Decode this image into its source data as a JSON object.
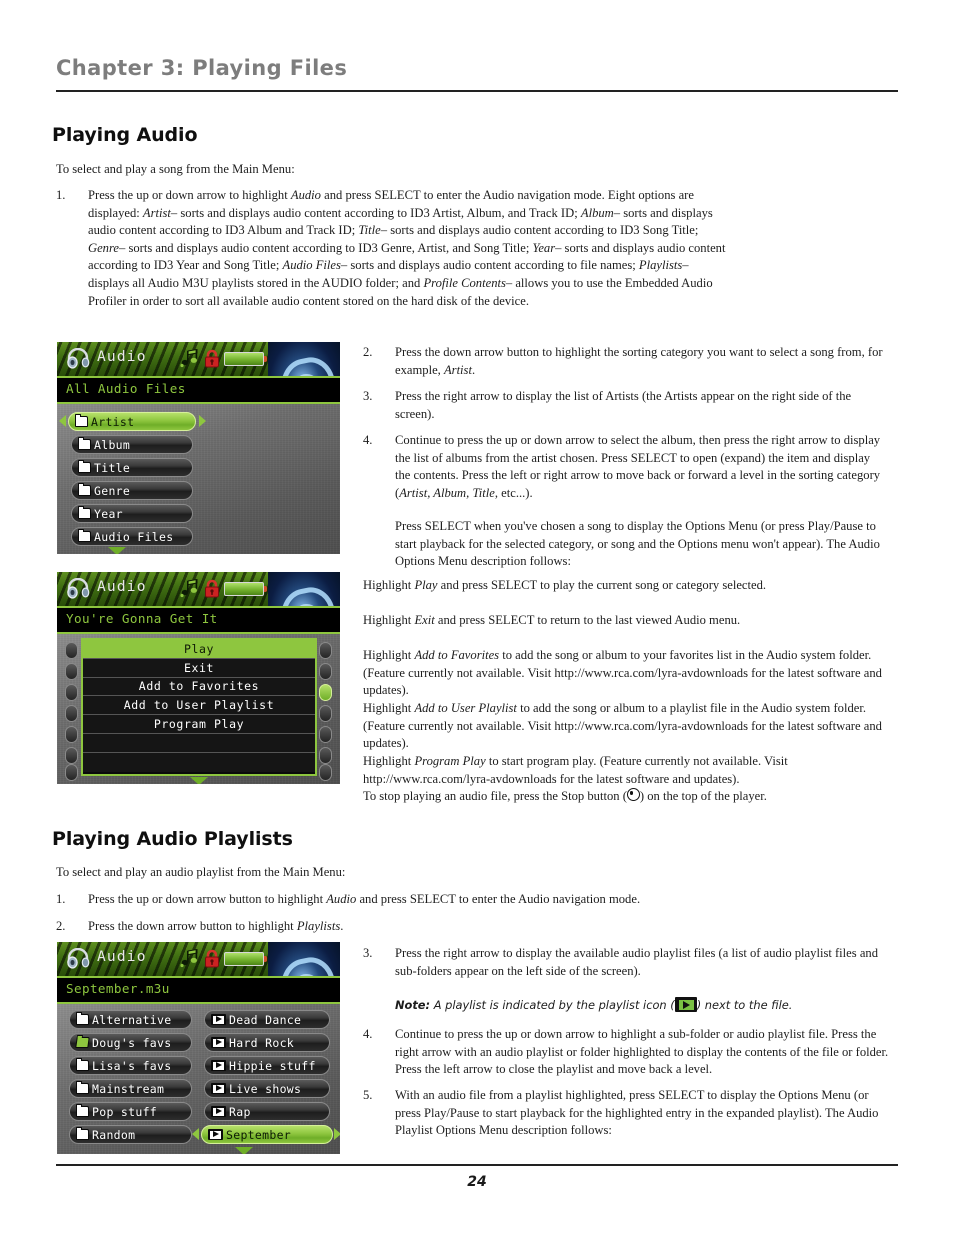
{
  "page": {
    "chapter_title": "Chapter 3: Playing Files",
    "page_number": "24"
  },
  "section_audio": {
    "heading": "Playing Audio",
    "intro": "To select and play a song from the Main Menu:",
    "step1_num": "1.",
    "step1_text": "Press the up or down arrow to highlight Audio and press SELECT to enter the Audio navigation mode. Eight options are displayed: Artist– sorts and displays audio content according to ID3 Artist, Album, and Track ID; Album– sorts and displays audio content according to ID3 Album and Track ID; Title– sorts and displays audio content according to ID3 Song Title; Genre– sorts and displays audio content according to ID3 Genre, Artist, and Song Title; Year– sorts and displays audio content according to ID3 Year and Song Title; Audio Files– sorts and displays audio content according to file names; Playlists– displays all Audio M3U playlists stored in the AUDIO folder; and Profile Contents– allows you to use the Embedded Audio Profiler in order to sort all available audio content stored on the hard disk of the device.",
    "step2_num": "2.",
    "step2_text": "Press the down arrow button to highlight the sorting category you want to select a song from, for example, Artist.",
    "step3_num": "3.",
    "step3_text": "Press the right arrow to display the list of Artists (the Artists appear on the right side of the screen).",
    "step4_num": "4.",
    "step4_text": "Continue to press the up or down arrow to select the album, then press the right arrow to display the list of albums from the artist chosen. Press SELECT to open (expand) the item and display the contents. Press the left or right arrow to move back or forward a level in the sorting category (Artist, Album, Title, etc...).",
    "step4_cont": "Press SELECT when you've chosen a song to display the Options Menu (or press Play/Pause to start playback for the selected category, or song and the Options menu won't appear). The Audio Options Menu description follows:",
    "opt_play": "Highlight Play and press SELECT to play the current song or category selected.",
    "opt_exit": "Highlight Exit and press SELECT to return to the last viewed Audio menu.",
    "opt_fav": "Highlight Add to Favorites to add the song or album to your favorites list in the Audio system folder. (Feature currently not available. Visit http://www.rca.com/lyra-avdownloads for the latest software and updates).",
    "opt_userpl": "Highlight Add to User Playlist to add the song or album to a playlist file in the Audio system folder. (Feature currently not available. Visit http://www.rca.com/lyra-avdownloads for the latest software and updates).",
    "opt_progplay": "Highlight Program Play to start program play. (Feature currently not available. Visit http://www.rca.com/lyra-avdownloads for the latest software and updates).",
    "stop_text_before": "To stop playing an audio file, press the Stop button (",
    "stop_text_after": ") on the top of the player."
  },
  "section_playlists": {
    "heading": "Playing Audio Playlists",
    "intro": "To select and play an audio playlist from the Main Menu:",
    "step1_num": "1.",
    "step1_text": "Press the up or down arrow button to highlight Audio and press SELECT to enter the Audio navigation mode.",
    "step2_num": "2.",
    "step2_text": "Press the down arrow button to highlight Playlists.",
    "step3_num": "3.",
    "step3_text": "Press the right arrow to display the available audio playlist files (a list of audio playlist files and sub-folders appear on the left side of the screen).",
    "note_label": "Note:",
    "note_before": " A playlist is indicated by the playlist icon (",
    "note_after": ")  next to the file.",
    "step4_num": "4.",
    "step4_text": "Continue to press the up or down arrow to highlight a sub-folder or audio playlist file. Press the right arrow with an audio playlist or folder highlighted to display the contents of the file or folder. Press the left arrow to close the playlist and move back a level.",
    "step5_num": "5.",
    "step5_text": "With an audio file from a playlist highlighted, press SELECT to display the Options Menu (or press Play/Pause to start playback for the highlighted entry in the expanded playlist). The Audio Playlist Options Menu description follows:"
  },
  "device1": {
    "title": "Audio",
    "subtitle": "All Audio Files",
    "items": [
      {
        "label": "Artist",
        "icon": "folder-icon",
        "selected": true
      },
      {
        "label": "Album",
        "icon": "folder-icon",
        "selected": false
      },
      {
        "label": "Title",
        "icon": "folder-icon",
        "selected": false
      },
      {
        "label": "Genre",
        "icon": "folder-icon",
        "selected": false
      },
      {
        "label": "Year",
        "icon": "folder-icon",
        "selected": false
      },
      {
        "label": "Audio Files",
        "icon": "folder-icon",
        "selected": false
      }
    ]
  },
  "device2": {
    "title": "Audio",
    "subtitle": "You're Gonna Get It",
    "menu": [
      {
        "label": "Play",
        "highlighted": true
      },
      {
        "label": "Exit",
        "highlighted": false
      },
      {
        "label": "Add to Favorites",
        "highlighted": false
      },
      {
        "label": "Add to User Playlist",
        "highlighted": false
      },
      {
        "label": "Program Play",
        "highlighted": false
      },
      {
        "label": "",
        "highlighted": false
      },
      {
        "label": "",
        "highlighted": false
      }
    ]
  },
  "device3": {
    "title": "Audio",
    "subtitle": "September.m3u",
    "left_items": [
      {
        "label": "Alternative",
        "icon": "folder-icon",
        "open": false,
        "selected": false
      },
      {
        "label": "Doug's favs",
        "icon": "folder-open-icon",
        "open": true,
        "selected": false
      },
      {
        "label": "Lisa's favs",
        "icon": "folder-icon",
        "open": false,
        "selected": false
      },
      {
        "label": "Mainstream",
        "icon": "folder-icon",
        "open": false,
        "selected": false
      },
      {
        "label": "Pop stuff",
        "icon": "folder-icon",
        "open": false,
        "selected": false
      },
      {
        "label": "Random",
        "icon": "folder-icon",
        "open": false,
        "selected": false
      }
    ],
    "right_items": [
      {
        "label": "Dead Dance",
        "icon": "playlist-icon",
        "selected": false
      },
      {
        "label": "Hard Rock",
        "icon": "playlist-icon",
        "selected": false
      },
      {
        "label": "Hippie stuff",
        "icon": "playlist-icon",
        "selected": false
      },
      {
        "label": "Live shows",
        "icon": "playlist-icon",
        "selected": false
      },
      {
        "label": "Rap",
        "icon": "playlist-icon",
        "selected": false
      },
      {
        "label": "September",
        "icon": "playlist-icon",
        "selected": true
      }
    ]
  },
  "colors": {
    "accent_green": "#8ec63f",
    "header_gray": "#7d7d7d",
    "lock_red": "#cc2222"
  }
}
